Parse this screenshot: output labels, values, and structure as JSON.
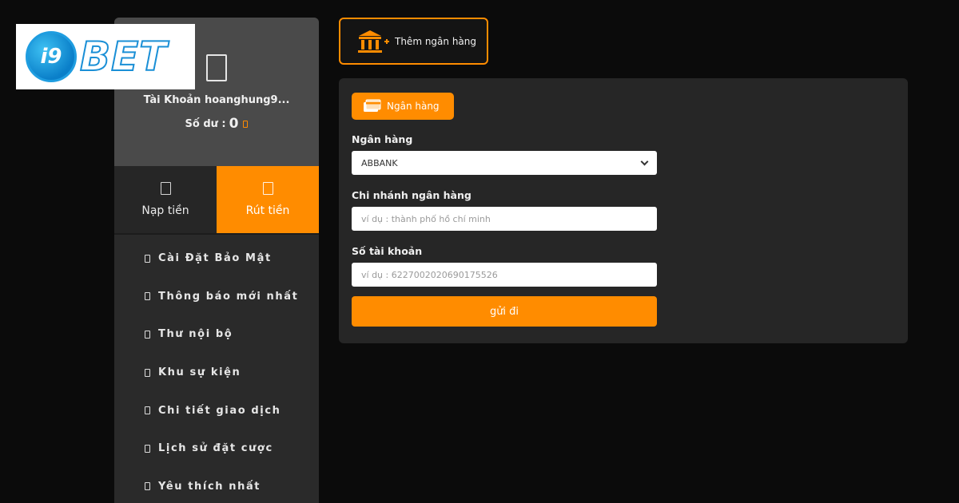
{
  "logo": {
    "badge": "i9",
    "text": "BET"
  },
  "profile": {
    "account_name": "Tài Khoản hoanghung9...",
    "balance_label": "Số dư :",
    "balance_value": "0"
  },
  "tabs": [
    {
      "label": "Nạp tiền",
      "active": false
    },
    {
      "label": "Rút tiền",
      "active": true
    }
  ],
  "menu": [
    {
      "label": "Cài Đặt Bảo Mật"
    },
    {
      "label": "Thông báo mới nhất"
    },
    {
      "label": "Thư nội bộ"
    },
    {
      "label": "Khu sự kiện"
    },
    {
      "label": "Chi tiết giao dịch"
    },
    {
      "label": "Lịch sử đặt cược"
    },
    {
      "label": "Yêu thích nhất"
    }
  ],
  "add_bank": {
    "label": "Thêm ngân hàng"
  },
  "form": {
    "tab_label": "Ngân hàng",
    "bank": {
      "label": "Ngân hàng",
      "value": "ABBANK"
    },
    "branch": {
      "label": "Chi nhánh ngân hàng",
      "placeholder": "ví dụ : thành phố hồ chí minh"
    },
    "account_number": {
      "label": "Số tài khoản",
      "placeholder": "ví dụ : 6227002020690175526"
    },
    "submit_label": "gửi đi"
  },
  "colors": {
    "accent": "#ff8c00",
    "sidebar": "#2a2a2a",
    "profile_bg": "#4a4a4a",
    "panel": "#262626",
    "background": "#0b0b0b",
    "logo_blue": "#1a8fd6"
  }
}
